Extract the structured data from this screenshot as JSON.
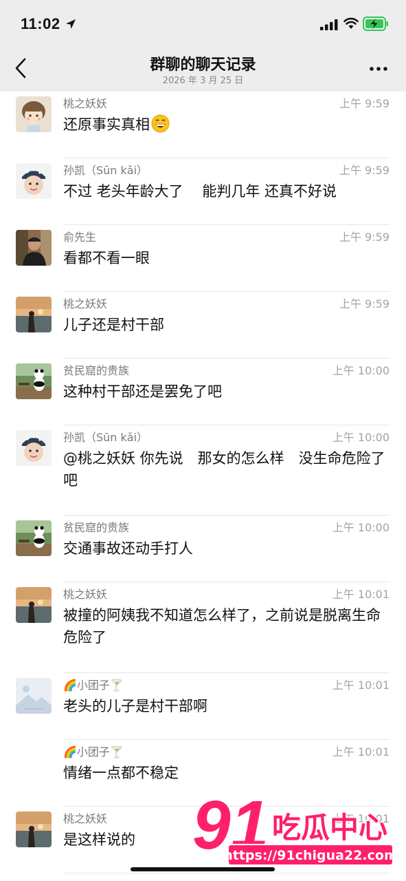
{
  "status": {
    "time": "11:02"
  },
  "nav": {
    "title": "群聊的聊天记录",
    "date": "2026 年 3 月 25 日"
  },
  "colors": {
    "background": "#ffffff",
    "header": "#ededed",
    "battery": "#33c759",
    "watermark": "#ff1f6a"
  },
  "messages": [
    {
      "sender": "桃之妖妖",
      "time": "上午 9:59",
      "text": "还原事实真相",
      "emoji": "grinning-face-emoji",
      "avatar": "cartoon-girl"
    },
    {
      "sender": "孙凯（Sūn kǎi）",
      "time": "上午 9:59",
      "text": "不过 老头年龄大了　 能判几年 还真不好说",
      "avatar": "baby-photo"
    },
    {
      "sender": "俞先生",
      "time": "上午 9:59",
      "text": "看都不看一眼",
      "avatar": "man-photo"
    },
    {
      "sender": "桃之妖妖",
      "time": "上午 9:59",
      "text": "儿子还是村干部",
      "avatar": "sunset-photo"
    },
    {
      "sender": "贫民窟的贵族",
      "time": "上午 10:00",
      "text": "这种村干部还是罢免了吧",
      "avatar": "panda-photo"
    },
    {
      "sender": "孙凯（Sūn kǎi）",
      "time": "上午 10:00",
      "text": "@桃之妖妖 你先说　那女的怎么样　没生命危险了吧",
      "avatar": "baby-photo"
    },
    {
      "sender": "贫民窟的贵族",
      "time": "上午 10:00",
      "text": "交通事故还动手打人",
      "avatar": "panda-photo"
    },
    {
      "sender": "桃之妖妖",
      "time": "上午 10:01",
      "text": "被撞的阿姨我不知道怎么样了，之前说是脱离生命危险了",
      "avatar": "sunset-photo"
    },
    {
      "sender": "🌈小团子🍸",
      "time": "上午 10:01",
      "text": "老头的儿子是村干部啊",
      "avatar": "placeholder-image"
    },
    {
      "sender": "🌈小团子🍸",
      "time": "上午 10:01",
      "text": "情绪一点都不稳定",
      "avatar": "none"
    },
    {
      "sender": "桃之妖妖",
      "time": "上午 10:01",
      "text": "是这样说的",
      "avatar": "sunset-photo"
    }
  ],
  "watermark": {
    "number": "91",
    "brand": "吃瓜中心",
    "url": "https://91chigua22.com"
  }
}
